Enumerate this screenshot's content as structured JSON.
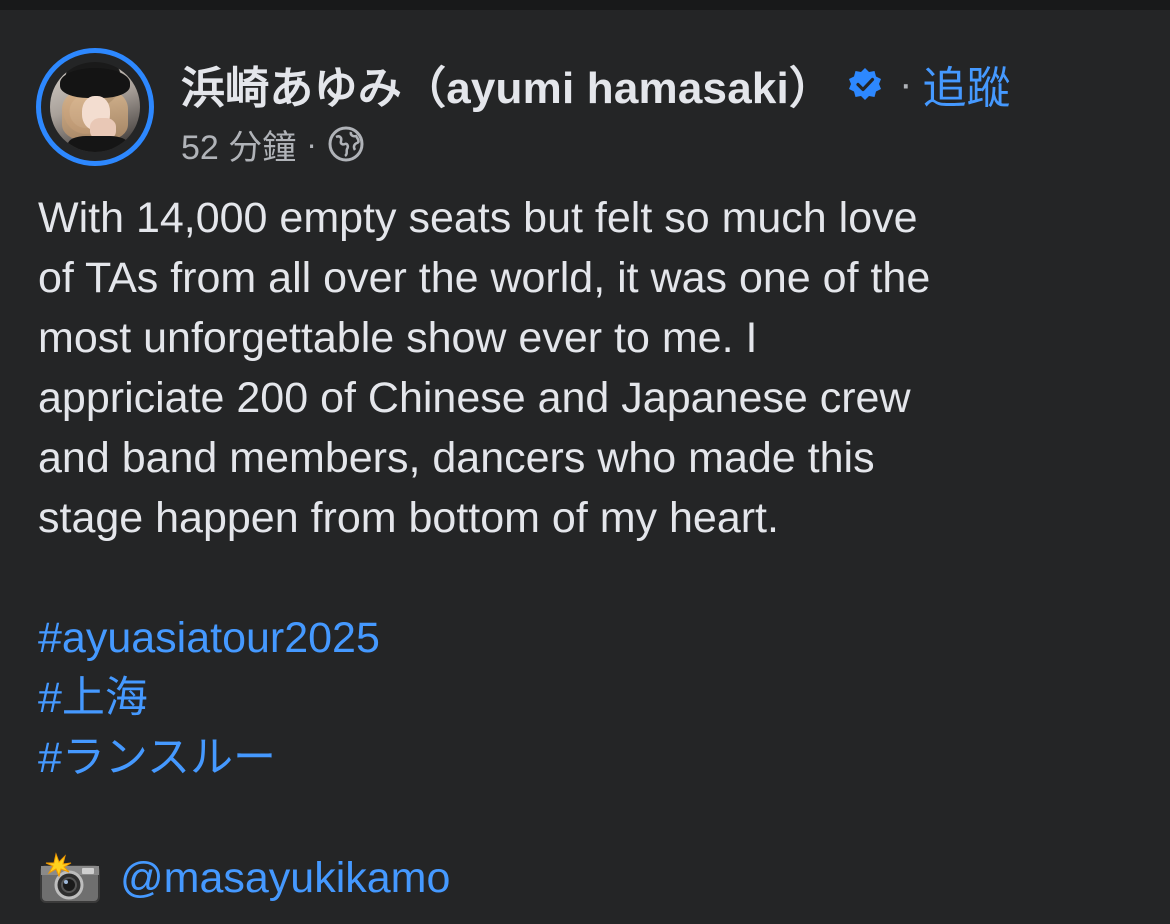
{
  "post": {
    "author_name": "浜崎あゆみ（ayumi hamasaki）",
    "follow_label": "追蹤",
    "separator": "·",
    "timestamp": "52 分鐘",
    "privacy_icon": "globe-icon",
    "verified_icon": "verified-badge-icon",
    "text": "With 14,000 empty seats but felt so much love\nof TAs from all over the world, it was one of the\nmost unforgettable show ever to me. I\nappriciate 200 of Chinese and Japanese crew\nand band members, dancers who made this\nstage happen from bottom of my heart.",
    "hashtags": [
      "#ayuasiatour2025",
      "#上海",
      "#ランスルー"
    ],
    "credit_icon": "camera-flash-icon",
    "credit_mention": "@masayukikamo"
  },
  "colors": {
    "background": "#242526",
    "text": "#e4e6eb",
    "secondary_text": "#b0b3b8",
    "link": "#4599ff",
    "avatar_ring": "#2d88ff",
    "verified": "#2d88ff"
  }
}
